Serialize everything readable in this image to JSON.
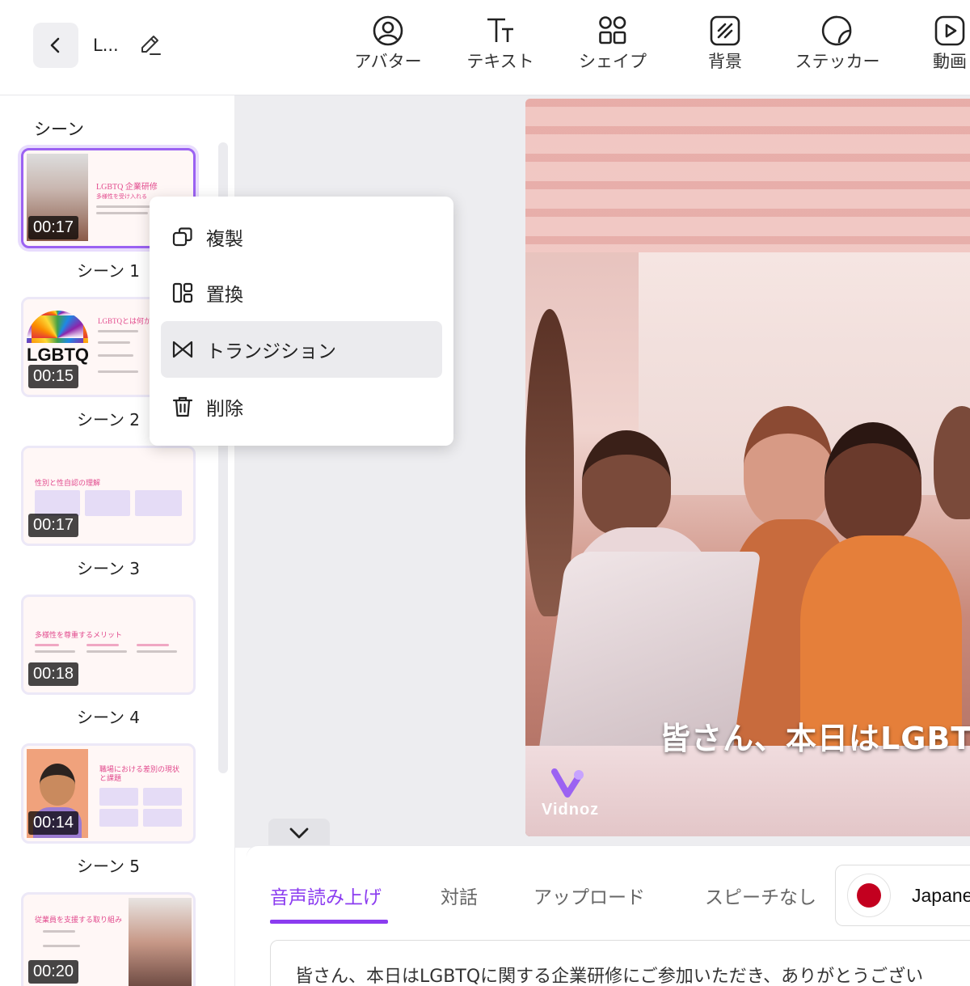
{
  "toolbar": {
    "project_title": "L...",
    "tools": [
      {
        "label": "アバター",
        "icon": "avatar-icon"
      },
      {
        "label": "テキスト",
        "icon": "text-icon"
      },
      {
        "label": "シェイプ",
        "icon": "shape-icon"
      },
      {
        "label": "背景",
        "icon": "background-icon"
      },
      {
        "label": "ステッカー",
        "icon": "sticker-icon"
      },
      {
        "label": "動画",
        "icon": "video-icon"
      }
    ]
  },
  "scenes": {
    "title": "シーン",
    "items": [
      {
        "label": "シーン 1",
        "duration": "00:17",
        "thumb_title": "LGBTQ 企業研修",
        "thumb_sub": "多様性を受け入れる"
      },
      {
        "label": "シーン 2",
        "duration": "00:15",
        "thumb_title": "LGBTQとは何か"
      },
      {
        "label": "シーン 3",
        "duration": "00:17",
        "thumb_title": "性別と性自認の理解"
      },
      {
        "label": "シーン 4",
        "duration": "00:18",
        "thumb_title": "多様性を尊重するメリット"
      },
      {
        "label": "シーン 5",
        "duration": "00:14",
        "thumb_title": "職場における差別の現状と課題"
      },
      {
        "label": "",
        "duration": "00:20",
        "thumb_title": "従業員を支援する取り組み"
      }
    ]
  },
  "context_menu": {
    "items": [
      {
        "label": "複製",
        "icon": "duplicate-icon"
      },
      {
        "label": "置換",
        "icon": "replace-icon"
      },
      {
        "label": "トランジション",
        "icon": "transition-icon"
      },
      {
        "label": "削除",
        "icon": "delete-icon"
      }
    ],
    "hovered_index": 2
  },
  "canvas": {
    "subtitle": "皆さん、本日はLGBTQ",
    "watermark": "Vidnoz"
  },
  "voice": {
    "tabs": [
      "音声読み上げ",
      "対話",
      "アップロード",
      "スピーチなし"
    ],
    "active_tab": "音声読み上げ",
    "language": "Japane",
    "script": "皆さん、本日はLGBTQに関する企業研修にご参加いただき、ありがとうござい"
  },
  "colors": {
    "accent": "#8b3cf0",
    "selected_border": "#9b62f2",
    "flag_red": "#c3001f"
  }
}
